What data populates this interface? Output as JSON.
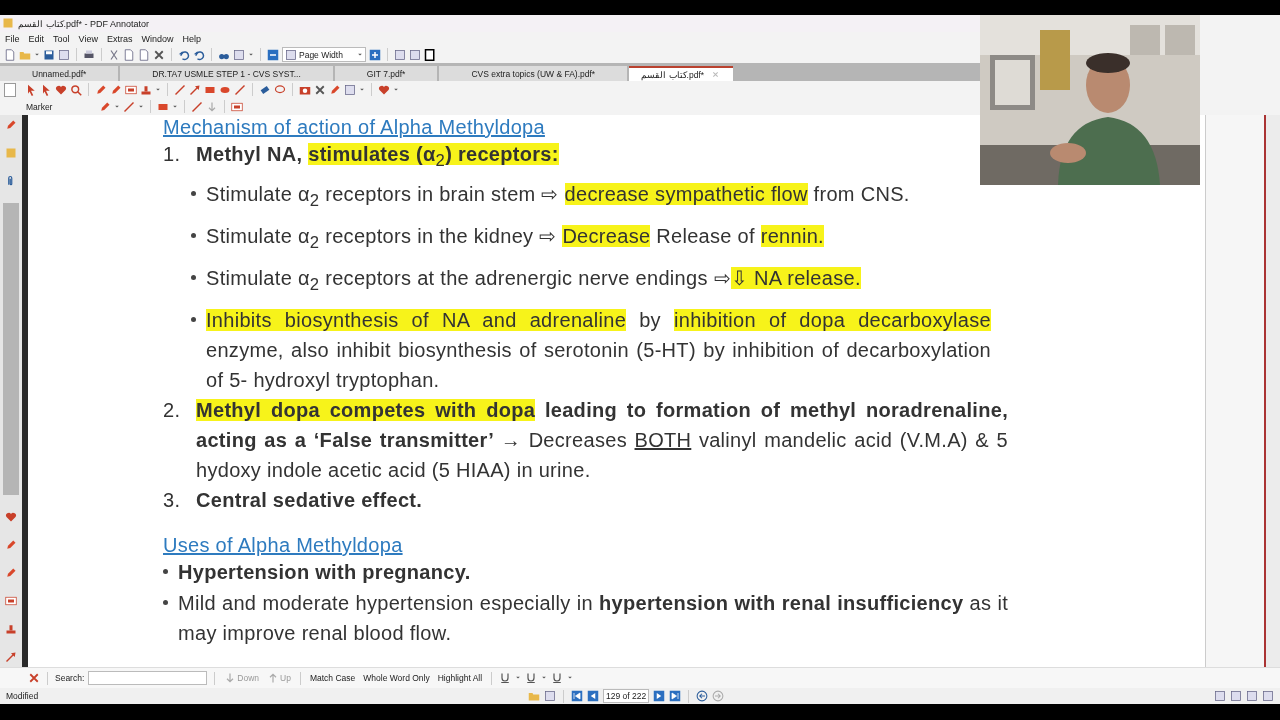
{
  "window": {
    "title": "كتاب القسم.pdf* - PDF Annotator"
  },
  "menu": [
    "File",
    "Edit",
    "Tool",
    "View",
    "Extras",
    "Window",
    "Help"
  ],
  "toolbar": {
    "zoom_mode": "Page Width"
  },
  "tabs": [
    {
      "label": "Unnamed.pdf*",
      "selected": false
    },
    {
      "label": "DR.TA7 USMLE STEP 1 - CVS SYST...",
      "selected": false
    },
    {
      "label": "GIT 7.pdf*",
      "selected": false
    },
    {
      "label": "CVS extra topics (UW & FA).pdf*",
      "selected": false
    },
    {
      "label": "كتاب القسم.pdf*",
      "selected": true
    }
  ],
  "tool_options": {
    "label": "Marker"
  },
  "document": {
    "blocks": [
      {
        "kind": "heading",
        "runs": [
          {
            "text": "Mechanism of action of Alpha Methyldopa",
            "highlighted": false,
            "underlined": true
          }
        ]
      },
      {
        "kind": "numbered",
        "number": "1.",
        "runs": [
          {
            "text": "**Methyl NA,** ",
            "highlighted": false,
            "underlined": false
          },
          {
            "text": "**stimulates (α**$_{2}$**) receptors:**",
            "highlighted": true,
            "underlined": false
          }
        ],
        "children": [
          {
            "kind": "bullet",
            "runs": [
              {
                "text": "Stimulate α$_{2}$ receptors in brain stem ⇨ ",
                "highlighted": false,
                "underlined": false
              },
              {
                "text": "decrease sympathetic flow",
                "highlighted": true,
                "underlined": false
              },
              {
                "text": " from CNS.",
                "highlighted": false,
                "underlined": false
              }
            ]
          },
          {
            "kind": "bullet",
            "runs": [
              {
                "text": "Stimulate α$_{2}$ receptors in the kidney ⇨ ",
                "highlighted": false,
                "underlined": false
              },
              {
                "text": "Decrease",
                "highlighted": true,
                "underlined": false
              },
              {
                "text": " Release of ",
                "highlighted": false,
                "underlined": false
              },
              {
                "text": "rennin.",
                "highlighted": true,
                "underlined": false
              }
            ]
          },
          {
            "kind": "bullet",
            "runs": [
              {
                "text": "Stimulate α$_{2}$ receptors at the adrenergic nerve endings ⇨",
                "highlighted": false,
                "underlined": false
              },
              {
                "text": "⇩ NA release.",
                "highlighted": true,
                "underlined": false
              }
            ]
          },
          {
            "kind": "bullet",
            "runs": [
              {
                "text": "Inhibits biosynthesis of NA and adrenaline",
                "highlighted": true,
                "underlined": false
              },
              {
                "text": " by ",
                "highlighted": false,
                "underlined": false
              },
              {
                "text": "inhibition of dopa decarboxylase",
                "highlighted": true,
                "underlined": false
              },
              {
                "text": " enzyme, also inhibit biosynthesis of serotonin (5-HT) by inhibition of decarboxylation of 5- hydroxyl tryptophan.",
                "highlighted": false,
                "underlined": false
              }
            ]
          }
        ]
      },
      {
        "kind": "numbered",
        "number": "2.",
        "runs": [
          {
            "text": "**Methyl dopa competes with dopa**",
            "highlighted": true,
            "underlined": false
          },
          {
            "text": " **leading to formation of methyl noradrenaline, acting as a ‘False transmitter’ →** Decreases ",
            "highlighted": false,
            "underlined": false
          },
          {
            "text": "BOTH",
            "highlighted": false,
            "underlined": true
          },
          {
            "text": " valinyl mandelic acid (V.M.A) & 5 hydoxy indole acetic acid (5 HIAA) in urine.",
            "highlighted": false,
            "underlined": false
          }
        ]
      },
      {
        "kind": "numbered",
        "number": "3.",
        "runs": [
          {
            "text": "**Central sedative effect.**",
            "highlighted": false,
            "underlined": false
          }
        ]
      },
      {
        "kind": "heading",
        "runs": [
          {
            "text": "Uses of Alpha Methyldopa",
            "highlighted": false,
            "underlined": true
          }
        ]
      },
      {
        "kind": "bullet",
        "runs": [
          {
            "text": "**Hypertension with pregnancy.**",
            "highlighted": false,
            "underlined": false
          }
        ]
      },
      {
        "kind": "bullet",
        "runs": [
          {
            "text": "Mild and moderate hypertension especially in **hypertension with renal insufficiency** as it may improve renal blood flow.",
            "highlighted": false,
            "underlined": false
          }
        ]
      }
    ]
  },
  "search_bar": {
    "label": "Search:",
    "buttons": [
      {
        "label": "Down",
        "disabled": true
      },
      {
        "label": "Up",
        "disabled": true
      }
    ],
    "options": [
      "Match Case",
      "Whole Word Only",
      "Highlight All"
    ]
  },
  "status_bar": {
    "state": "Modified",
    "page": "129 of 222"
  }
}
